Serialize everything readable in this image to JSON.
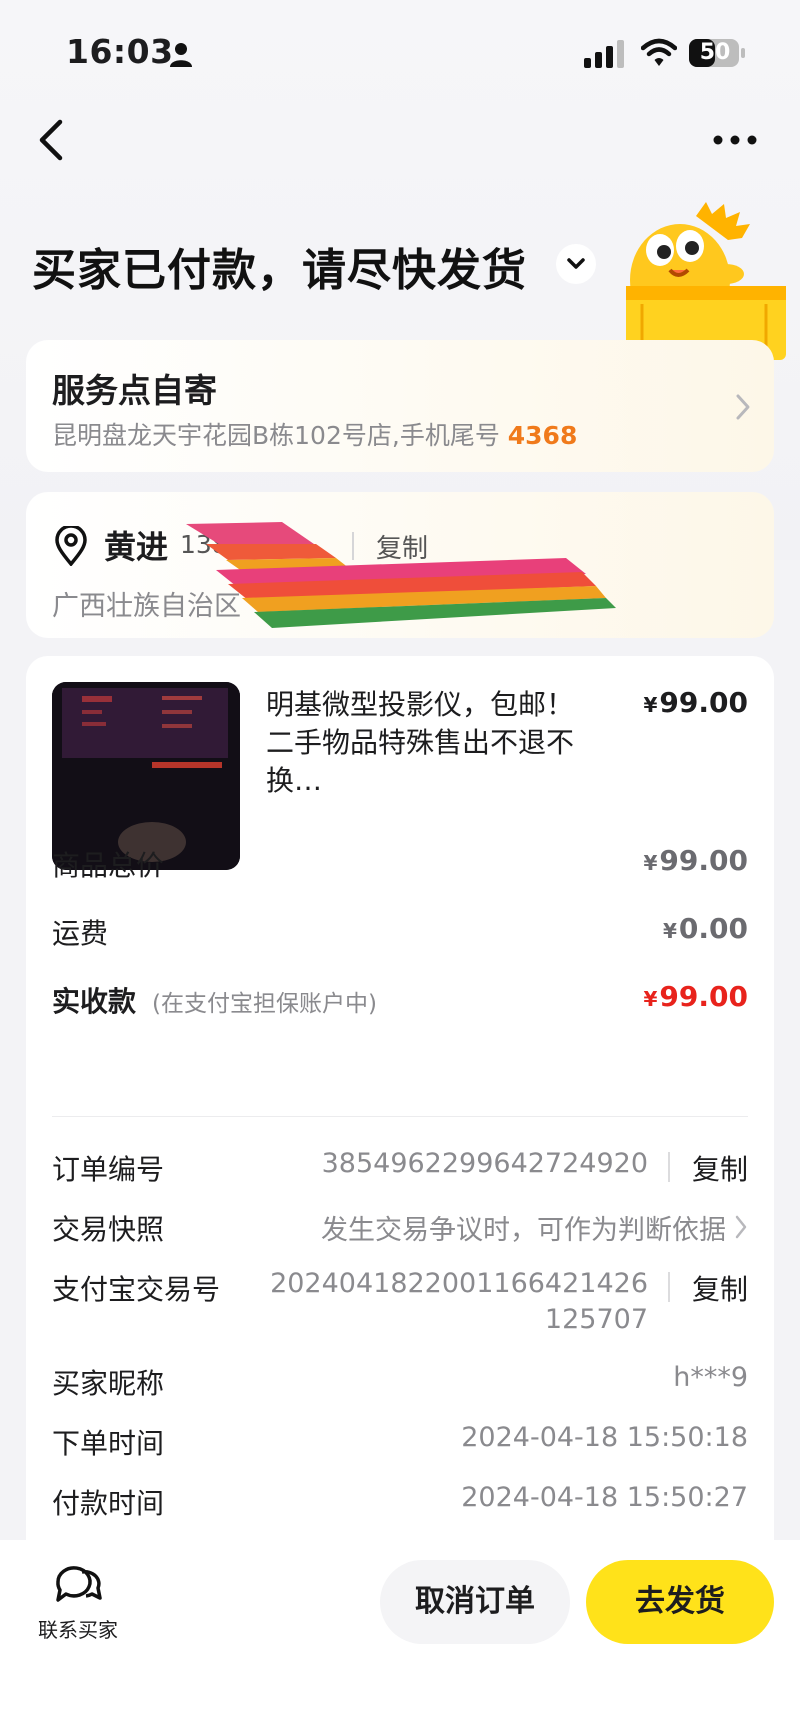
{
  "status_bar": {
    "time": "16:03",
    "battery": "50"
  },
  "header": {
    "title": "买家已付款，请尽快发货"
  },
  "pickup": {
    "title": "服务点自寄",
    "address": "昆明盘龙天宇花园B栋102号店,手机尾号 ",
    "phone_tail": "4368"
  },
  "address": {
    "name": "黄进",
    "phone": "1387",
    "copy_label": "复制",
    "line": "广西壮族自治区"
  },
  "product": {
    "title": "明基微型投影仪，包邮！二手物品特殊售出不退不换…",
    "price": "99.00",
    "currency": "¥"
  },
  "summary": {
    "total_label": "商品总价",
    "total_value": "99.00",
    "shipping_label": "运费",
    "shipping_value": "0.00",
    "received_label": "实收款",
    "received_note": "(在支付宝担保账户中)",
    "received_value": "99.00"
  },
  "order_info": {
    "order_no_label": "订单编号",
    "order_no": "3854962299642724920",
    "copy_label": "复制",
    "snapshot_label": "交易快照",
    "snapshot_value": "发生交易争议时，可作为判断依据",
    "alipay_label": "支付宝交易号",
    "alipay_no_1": "2024041822001166421426",
    "alipay_no_2": "125707",
    "buyer_label": "买家昵称",
    "buyer_value": "h***9",
    "order_time_label": "下单时间",
    "order_time": "2024-04-18 15:50:18",
    "pay_time_label": "付款时间",
    "pay_time": "2024-04-18 15:50:27"
  },
  "bottom_bar": {
    "contact_label": "联系买家",
    "cancel_label": "取消订单",
    "ship_label": "去发货"
  },
  "colors": {
    "accent": "#ffe21a",
    "price_red": "#e8231c",
    "phone_orange": "#f07a1b"
  }
}
